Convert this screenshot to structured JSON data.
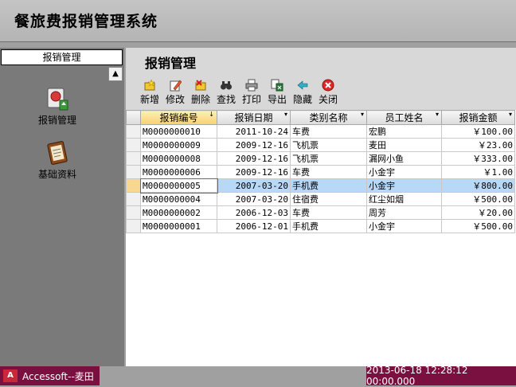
{
  "window": {
    "title": "餐旅费报销管理系统"
  },
  "sidebar": {
    "tab_label": "报销管理",
    "scroll_glyph": "▲",
    "items": [
      {
        "label": "报销管理",
        "icon": "expense-report-icon"
      },
      {
        "label": "基础资料",
        "icon": "clipboard-icon"
      }
    ]
  },
  "main": {
    "title": "报销管理",
    "toolbar": [
      {
        "label": "新增",
        "icon": "new-icon"
      },
      {
        "label": "修改",
        "icon": "edit-icon"
      },
      {
        "label": "删除",
        "icon": "delete-icon"
      },
      {
        "label": "查找",
        "icon": "find-icon"
      },
      {
        "label": "打印",
        "icon": "print-icon"
      },
      {
        "label": "导出",
        "icon": "export-icon"
      },
      {
        "label": "隐藏",
        "icon": "hide-icon"
      },
      {
        "label": "关闭",
        "icon": "close-icon"
      }
    ],
    "grid": {
      "columns": [
        "报销编号",
        "报销日期",
        "类别名称",
        "员工姓名",
        "报销金额"
      ],
      "sort_glyph": "↓",
      "dropdown_glyph": "▾",
      "current_row": 4,
      "rows": [
        [
          "M0000000010",
          "2011-10-24",
          "车费",
          "宏鹏",
          "￥100.00"
        ],
        [
          "M0000000009",
          "2009-12-16",
          "飞机票",
          "麦田",
          "￥23.00"
        ],
        [
          "M0000000008",
          "2009-12-16",
          "飞机票",
          "漏网小鱼",
          "￥333.00"
        ],
        [
          "M0000000006",
          "2009-12-16",
          "车费",
          "小金宇",
          "￥1.00"
        ],
        [
          "M0000000005",
          "2007-03-20",
          "手机费",
          "小金宇",
          "￥800.00"
        ],
        [
          "M0000000004",
          "2007-03-20",
          "住宿费",
          "红尘如烟",
          "￥500.00"
        ],
        [
          "M0000000002",
          "2006-12-03",
          "车费",
          "周芳",
          "￥20.00"
        ],
        [
          "M0000000001",
          "2006-12-01",
          "手机费",
          "小金宇",
          "￥500.00"
        ]
      ]
    }
  },
  "status": {
    "app": "Accessoft--麦田",
    "datetime": "2013-06-18 12:28:12 00:00.000"
  },
  "colors": {
    "status_bg": "#7a1040",
    "selected_row": "#b8d8f8",
    "sidebar_bg": "#7a7a7a"
  }
}
